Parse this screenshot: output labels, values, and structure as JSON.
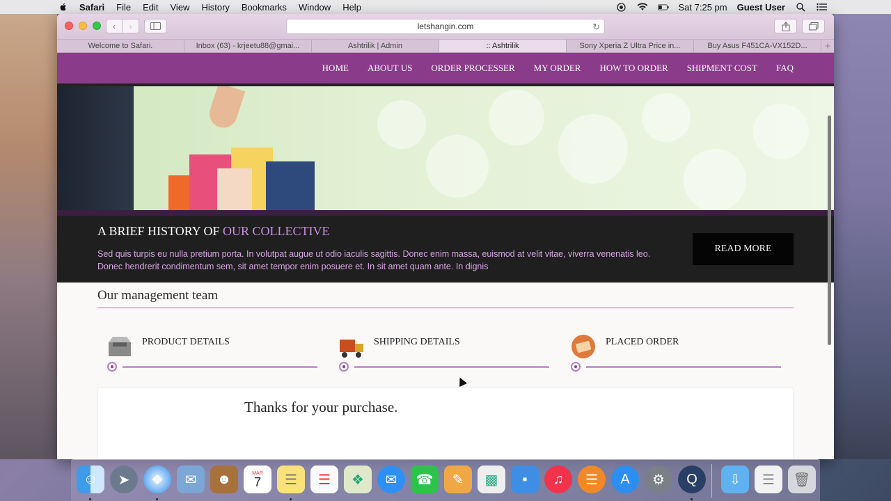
{
  "menubar": {
    "app": "Safari",
    "items": [
      "File",
      "Edit",
      "View",
      "History",
      "Bookmarks",
      "Window",
      "Help"
    ],
    "clock": "Sat 7:25 pm",
    "user": "Guest User"
  },
  "browser": {
    "url": "letshangin.com",
    "tabs": [
      {
        "label": "Welcome to Safari."
      },
      {
        "label": "Inbox (63) - krjeetu88@gmai..."
      },
      {
        "label": "Ashtrilik | Admin"
      },
      {
        "label": ":: Ashtrilik"
      },
      {
        "label": "Sony Xperia Z Ultra Price in..."
      },
      {
        "label": "Buy Asus F451CA-VX152D..."
      }
    ],
    "plus": "+"
  },
  "site": {
    "nav": [
      "HOME",
      "ABOUT US",
      "ORDER PROCESSER",
      "MY ORDER",
      "HOW TO ORDER",
      "SHIPMENT COST",
      "FAQ"
    ],
    "history": {
      "title_plain": "A BRIEF HISTORY OF",
      "title_accent": "OUR COLLECTIVE",
      "body": "Sed quis turpis eu nulla pretium porta. In volutpat augue ut odio iaculis sagittis. Donec enim massa, euismod at velit vitae, viverra venenatis leo. Donec hendrerit condimentum sem, sit amet tempor enim posuere et. In sit amet quam ante. In dignis",
      "button": "READ MORE"
    },
    "team_title": "Our management team",
    "steps": [
      {
        "label": "PRODUCT DETAILS",
        "icon": "box-icon"
      },
      {
        "label": "SHIPPING DETAILS",
        "icon": "truck-icon"
      },
      {
        "label": "PLACED ORDER",
        "icon": "payment-card-icon"
      }
    ],
    "thanks": "Thanks for your purchase."
  },
  "dock": {
    "calendar_month": "MAR",
    "calendar_day": "7"
  },
  "colors": {
    "nav_purple": "#8a3b8a",
    "accent_lilac": "#c88fe0",
    "body_text_lilac": "#d9a5e6"
  }
}
